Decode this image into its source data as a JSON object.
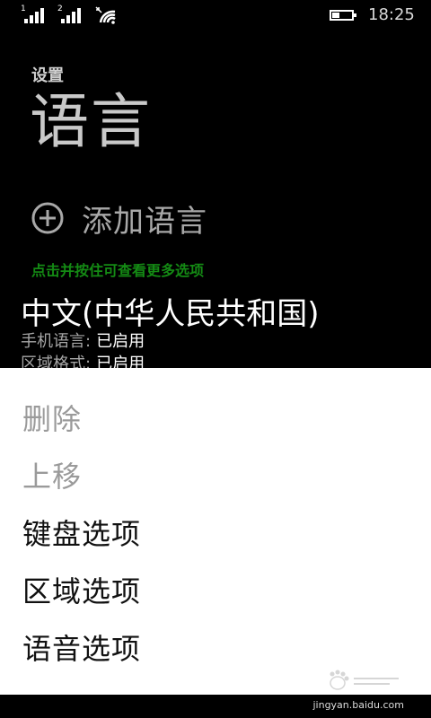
{
  "status_bar": {
    "sim1": "1",
    "sim2": "2",
    "time": "18:25",
    "icons": [
      "signal-icon",
      "signal-icon",
      "wifi-icon",
      "battery-icon"
    ]
  },
  "header": {
    "app_title": "设置",
    "page_title": "语言"
  },
  "add_language": {
    "label": "添加语言",
    "icon": "plus-circle-icon"
  },
  "hint": "点击并按住可查看更多选项",
  "language": {
    "name": "中文(中华人民共和国)",
    "phone_language_label": "手机语言:",
    "phone_language_value": "已启用",
    "region_format_label": "区域格式:",
    "region_format_value": "已启用"
  },
  "context_menu": {
    "items": [
      {
        "label": "删除",
        "enabled": false
      },
      {
        "label": "上移",
        "enabled": false
      },
      {
        "label": "键盘选项",
        "enabled": true
      },
      {
        "label": "区域选项",
        "enabled": true
      },
      {
        "label": "语音选项",
        "enabled": true
      }
    ]
  },
  "footer": {
    "site": "jingyan.baidu.com"
  },
  "colors": {
    "background": "#000000",
    "accent_hint": "#148a14",
    "menu_background": "#ffffff"
  }
}
